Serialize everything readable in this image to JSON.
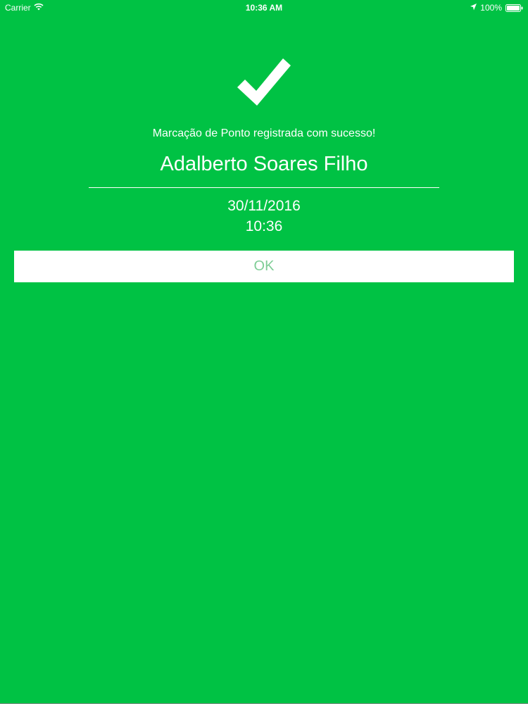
{
  "status_bar": {
    "carrier": "Carrier",
    "time": "10:36 AM",
    "battery": "100%",
    "icons": [
      "wifi-icon",
      "location-icon",
      "battery-icon"
    ]
  },
  "confirmation": {
    "icon": "checkmark-icon",
    "message": "Marcação de Ponto registrada com sucesso!",
    "name": "Adalberto Soares Filho",
    "date": "30/11/2016",
    "time": "10:36",
    "ok_label": "OK"
  },
  "colors": {
    "background": "#00c244",
    "button_background": "#ffffff",
    "button_text": "#7fcd96",
    "text": "#ffffff"
  }
}
